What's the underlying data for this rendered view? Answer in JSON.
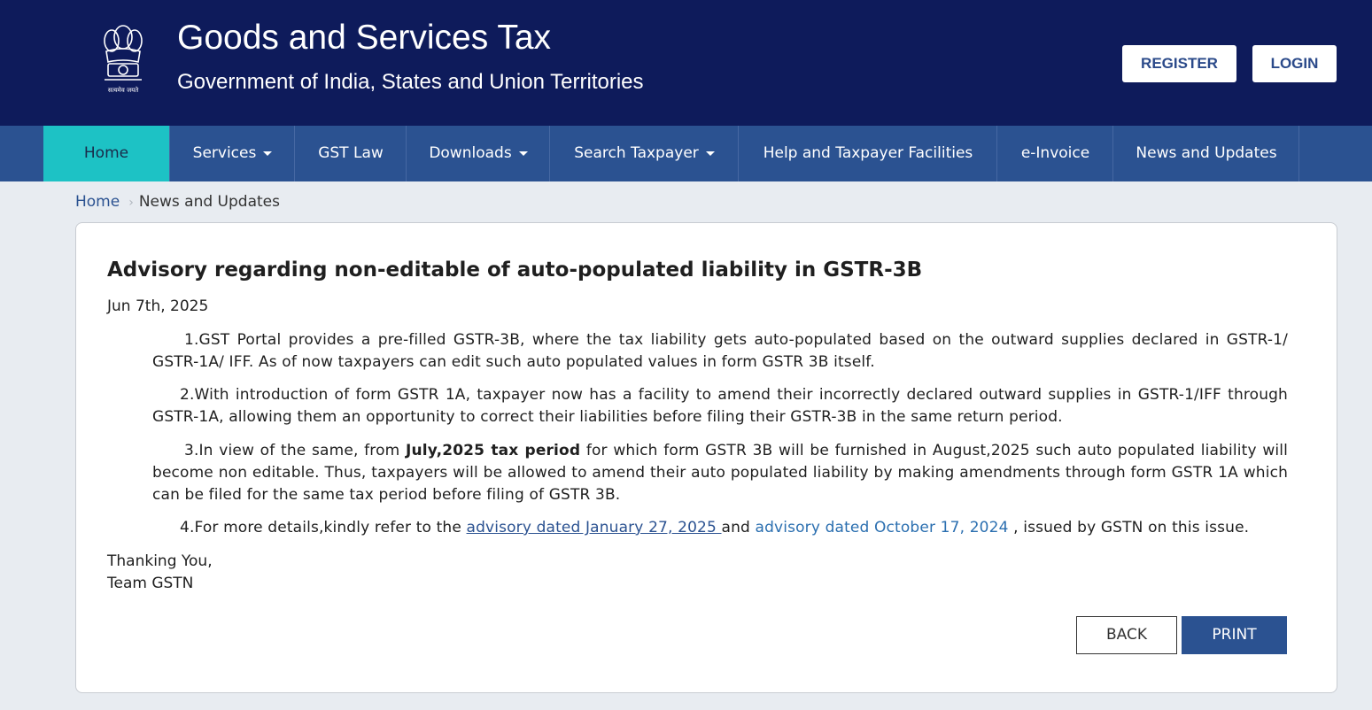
{
  "header": {
    "title": "Goods and Services Tax",
    "subtitle": "Government of India, States and Union Territories",
    "register_label": "REGISTER",
    "login_label": "LOGIN",
    "emblem_icon": "india-emblem-icon",
    "emblem_motto": "सत्यमेव जयते"
  },
  "nav": {
    "items": [
      {
        "label": "Home",
        "active": true
      },
      {
        "label": "Services",
        "dropdown": true
      },
      {
        "label": "GST Law"
      },
      {
        "label": "Downloads",
        "dropdown": true
      },
      {
        "label": "Search Taxpayer",
        "dropdown": true
      },
      {
        "label": "Help and Taxpayer Facilities"
      },
      {
        "label": "e-Invoice"
      },
      {
        "label": "News and Updates"
      }
    ]
  },
  "breadcrumb": {
    "home": "Home",
    "current": "News and Updates"
  },
  "advisory": {
    "title": "Advisory regarding non-editable of auto-populated liability in GSTR-3B",
    "date": "Jun 7th, 2025",
    "p1": "1.GST Portal provides a pre-filled GSTR-3B, where the tax liability gets auto-populated based on the outward supplies declared in GSTR-1/ GSTR-1A/ IFF. As of now taxpayers can edit such auto populated values in form GSTR 3B itself.",
    "p2": "2.With introduction of form GSTR 1A, taxpayer now has a facility to amend their incorrectly declared outward supplies in GSTR-1/IFF through GSTR-1A, allowing them an opportunity to correct their liabilities before filing their GSTR-3B in the same return period.",
    "p3_prefix": "3.In view of the same, from ",
    "p3_bold": "July,2025 tax period",
    "p3_suffix": " for which form GSTR 3B will be furnished in August,2025 such auto populated liability will become non editable. Thus, taxpayers will be allowed to amend their auto populated liability by making amendments through form GSTR 1A which can be filed for the same tax period before filing of GSTR 3B.",
    "p4_prefix": "4.For more details,kindly refer to the ",
    "p4_link1": "advisory dated January 27, 2025 ",
    "p4_mid": "and ",
    "p4_link2": "advisory dated October 17, 2024",
    "p4_suffix": " , issued by GSTN on this issue.",
    "closing_line1": "Thanking You,",
    "closing_line2": "Team GSTN",
    "back_label": "BACK",
    "print_label": "PRINT"
  },
  "colors": {
    "header_bg": "#0e1b5b",
    "nav_bg": "#2b5291",
    "nav_active": "#1dc2c5",
    "page_bg": "#e8ecf1"
  }
}
